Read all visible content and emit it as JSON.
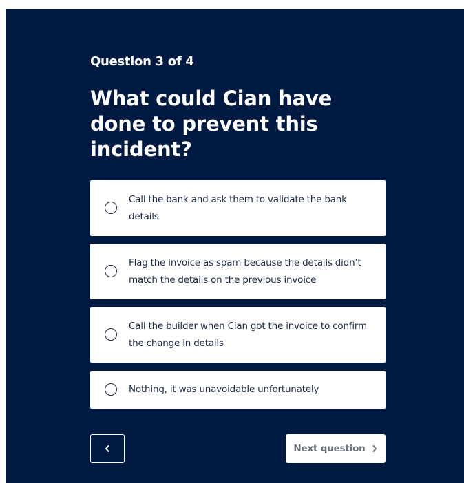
{
  "quiz": {
    "counter": "Question 3 of 4",
    "question": "What could Cian have done to prevent this incident?",
    "options": [
      {
        "label": "Call the bank and ask them to validate the bank details",
        "selected": false
      },
      {
        "label": "Flag the invoice as spam because the details didn’t match the details on the previous invoice",
        "selected": false
      },
      {
        "label": "Call the builder when Cian got the invoice to confirm the change in details",
        "selected": false
      },
      {
        "label": "Nothing, it was unavoidable unfortunately",
        "selected": false
      }
    ]
  },
  "navigation": {
    "back_icon": "chevron-left-icon",
    "next_label": "Next question",
    "next_icon": "chevron-right-icon",
    "next_enabled": false
  },
  "colors": {
    "panel_background": "#001a41",
    "option_background": "#ffffff",
    "text_on_dark": "#ffffff",
    "option_text": "#1f2a44",
    "next_label_disabled": "#6b6f78"
  }
}
